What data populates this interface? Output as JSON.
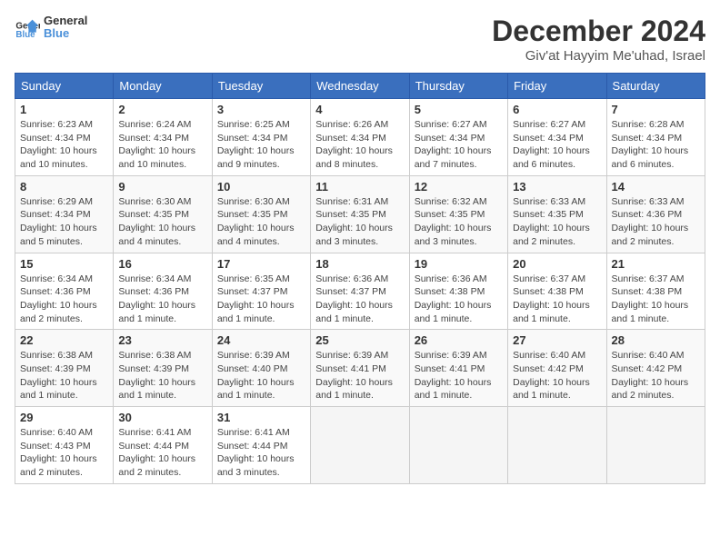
{
  "logo": {
    "text_general": "General",
    "text_blue": "Blue"
  },
  "header": {
    "month": "December 2024",
    "location": "Giv'at Hayyim Me'uhad, Israel"
  },
  "weekdays": [
    "Sunday",
    "Monday",
    "Tuesday",
    "Wednesday",
    "Thursday",
    "Friday",
    "Saturday"
  ],
  "weeks": [
    [
      {
        "day": "1",
        "sunrise": "Sunrise: 6:23 AM",
        "sunset": "Sunset: 4:34 PM",
        "daylight": "Daylight: 10 hours and 10 minutes."
      },
      {
        "day": "2",
        "sunrise": "Sunrise: 6:24 AM",
        "sunset": "Sunset: 4:34 PM",
        "daylight": "Daylight: 10 hours and 10 minutes."
      },
      {
        "day": "3",
        "sunrise": "Sunrise: 6:25 AM",
        "sunset": "Sunset: 4:34 PM",
        "daylight": "Daylight: 10 hours and 9 minutes."
      },
      {
        "day": "4",
        "sunrise": "Sunrise: 6:26 AM",
        "sunset": "Sunset: 4:34 PM",
        "daylight": "Daylight: 10 hours and 8 minutes."
      },
      {
        "day": "5",
        "sunrise": "Sunrise: 6:27 AM",
        "sunset": "Sunset: 4:34 PM",
        "daylight": "Daylight: 10 hours and 7 minutes."
      },
      {
        "day": "6",
        "sunrise": "Sunrise: 6:27 AM",
        "sunset": "Sunset: 4:34 PM",
        "daylight": "Daylight: 10 hours and 6 minutes."
      },
      {
        "day": "7",
        "sunrise": "Sunrise: 6:28 AM",
        "sunset": "Sunset: 4:34 PM",
        "daylight": "Daylight: 10 hours and 6 minutes."
      }
    ],
    [
      {
        "day": "8",
        "sunrise": "Sunrise: 6:29 AM",
        "sunset": "Sunset: 4:34 PM",
        "daylight": "Daylight: 10 hours and 5 minutes."
      },
      {
        "day": "9",
        "sunrise": "Sunrise: 6:30 AM",
        "sunset": "Sunset: 4:35 PM",
        "daylight": "Daylight: 10 hours and 4 minutes."
      },
      {
        "day": "10",
        "sunrise": "Sunrise: 6:30 AM",
        "sunset": "Sunset: 4:35 PM",
        "daylight": "Daylight: 10 hours and 4 minutes."
      },
      {
        "day": "11",
        "sunrise": "Sunrise: 6:31 AM",
        "sunset": "Sunset: 4:35 PM",
        "daylight": "Daylight: 10 hours and 3 minutes."
      },
      {
        "day": "12",
        "sunrise": "Sunrise: 6:32 AM",
        "sunset": "Sunset: 4:35 PM",
        "daylight": "Daylight: 10 hours and 3 minutes."
      },
      {
        "day": "13",
        "sunrise": "Sunrise: 6:33 AM",
        "sunset": "Sunset: 4:35 PM",
        "daylight": "Daylight: 10 hours and 2 minutes."
      },
      {
        "day": "14",
        "sunrise": "Sunrise: 6:33 AM",
        "sunset": "Sunset: 4:36 PM",
        "daylight": "Daylight: 10 hours and 2 minutes."
      }
    ],
    [
      {
        "day": "15",
        "sunrise": "Sunrise: 6:34 AM",
        "sunset": "Sunset: 4:36 PM",
        "daylight": "Daylight: 10 hours and 2 minutes."
      },
      {
        "day": "16",
        "sunrise": "Sunrise: 6:34 AM",
        "sunset": "Sunset: 4:36 PM",
        "daylight": "Daylight: 10 hours and 1 minute."
      },
      {
        "day": "17",
        "sunrise": "Sunrise: 6:35 AM",
        "sunset": "Sunset: 4:37 PM",
        "daylight": "Daylight: 10 hours and 1 minute."
      },
      {
        "day": "18",
        "sunrise": "Sunrise: 6:36 AM",
        "sunset": "Sunset: 4:37 PM",
        "daylight": "Daylight: 10 hours and 1 minute."
      },
      {
        "day": "19",
        "sunrise": "Sunrise: 6:36 AM",
        "sunset": "Sunset: 4:38 PM",
        "daylight": "Daylight: 10 hours and 1 minute."
      },
      {
        "day": "20",
        "sunrise": "Sunrise: 6:37 AM",
        "sunset": "Sunset: 4:38 PM",
        "daylight": "Daylight: 10 hours and 1 minute."
      },
      {
        "day": "21",
        "sunrise": "Sunrise: 6:37 AM",
        "sunset": "Sunset: 4:38 PM",
        "daylight": "Daylight: 10 hours and 1 minute."
      }
    ],
    [
      {
        "day": "22",
        "sunrise": "Sunrise: 6:38 AM",
        "sunset": "Sunset: 4:39 PM",
        "daylight": "Daylight: 10 hours and 1 minute."
      },
      {
        "day": "23",
        "sunrise": "Sunrise: 6:38 AM",
        "sunset": "Sunset: 4:39 PM",
        "daylight": "Daylight: 10 hours and 1 minute."
      },
      {
        "day": "24",
        "sunrise": "Sunrise: 6:39 AM",
        "sunset": "Sunset: 4:40 PM",
        "daylight": "Daylight: 10 hours and 1 minute."
      },
      {
        "day": "25",
        "sunrise": "Sunrise: 6:39 AM",
        "sunset": "Sunset: 4:41 PM",
        "daylight": "Daylight: 10 hours and 1 minute."
      },
      {
        "day": "26",
        "sunrise": "Sunrise: 6:39 AM",
        "sunset": "Sunset: 4:41 PM",
        "daylight": "Daylight: 10 hours and 1 minute."
      },
      {
        "day": "27",
        "sunrise": "Sunrise: 6:40 AM",
        "sunset": "Sunset: 4:42 PM",
        "daylight": "Daylight: 10 hours and 1 minute."
      },
      {
        "day": "28",
        "sunrise": "Sunrise: 6:40 AM",
        "sunset": "Sunset: 4:42 PM",
        "daylight": "Daylight: 10 hours and 2 minutes."
      }
    ],
    [
      {
        "day": "29",
        "sunrise": "Sunrise: 6:40 AM",
        "sunset": "Sunset: 4:43 PM",
        "daylight": "Daylight: 10 hours and 2 minutes."
      },
      {
        "day": "30",
        "sunrise": "Sunrise: 6:41 AM",
        "sunset": "Sunset: 4:44 PM",
        "daylight": "Daylight: 10 hours and 2 minutes."
      },
      {
        "day": "31",
        "sunrise": "Sunrise: 6:41 AM",
        "sunset": "Sunset: 4:44 PM",
        "daylight": "Daylight: 10 hours and 3 minutes."
      },
      null,
      null,
      null,
      null
    ]
  ]
}
